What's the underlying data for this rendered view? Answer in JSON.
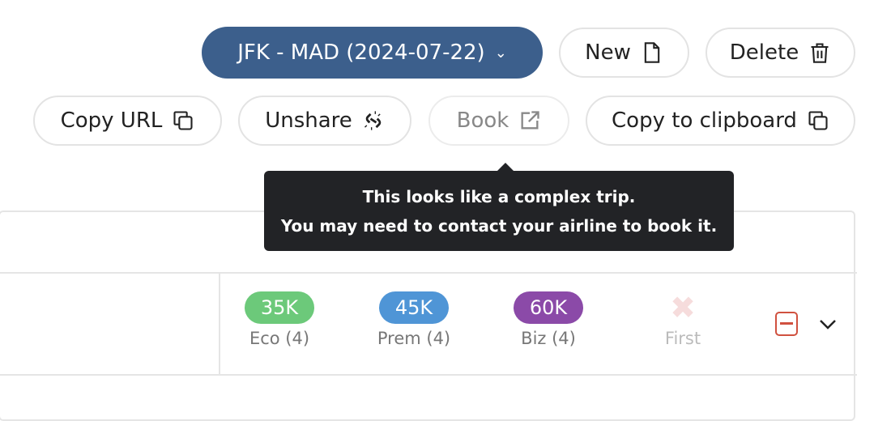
{
  "toolbar": {
    "route_label": "JFK - MAD (2024-07-22)",
    "new_label": "New",
    "delete_label": "Delete",
    "copy_url_label": "Copy URL",
    "unshare_label": "Unshare",
    "book_label": "Book",
    "copy_clipboard_label": "Copy to clipboard"
  },
  "tooltip": {
    "line1": "This looks like a complex trip.",
    "line2": "You may need to contact your airline to book it."
  },
  "cabins": [
    {
      "value": "35K",
      "label": "Eco (4)",
      "color": "#6cc97a"
    },
    {
      "value": "45K",
      "label": "Prem (4)",
      "color": "#4f95d6"
    },
    {
      "value": "60K",
      "label": "Biz (4)",
      "color": "#8b4aa8"
    },
    {
      "value": "",
      "label": "First",
      "color": "#f6dcdc"
    }
  ],
  "colors": {
    "primary": "#3c5f8c",
    "remove": "#d0513f"
  }
}
